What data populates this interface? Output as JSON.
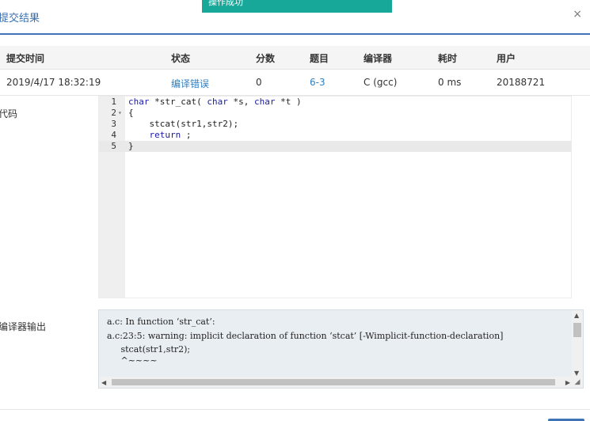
{
  "toast": {
    "text": "操作成功"
  },
  "header": {
    "title": "提交结果",
    "close_icon": "×"
  },
  "table": {
    "columns": [
      "提交时间",
      "状态",
      "分数",
      "题目",
      "编译器",
      "耗时",
      "用户"
    ],
    "row": [
      "2019/4/17 18:32:19",
      "编译错误",
      "0",
      "6-3",
      "C (gcc)",
      "0 ms",
      "20188721"
    ]
  },
  "labels": {
    "code": "代码",
    "compiler_output": "编译器输出"
  },
  "code_lines": [
    {
      "num": "1",
      "fold": ""
    },
    {
      "num": "2",
      "fold": "▾"
    },
    {
      "num": "3",
      "fold": ""
    },
    {
      "num": "4",
      "fold": ""
    },
    {
      "num": "5",
      "fold": ""
    }
  ],
  "code_text": {
    "l1_kw1": "char",
    "l1_a": " *str_cat( ",
    "l1_kw2": "char",
    "l1_b": " *s, ",
    "l1_kw3": "char",
    "l1_c": " *t )",
    "l2": "{",
    "l3": "    stcat(str1,str2);",
    "l4_indent": "    ",
    "l4_kw": "return",
    "l4_rest": " ;",
    "l5": "}"
  },
  "compiler_output": [
    "a.c: In function ‘str_cat’:",
    "a.c:23:5: warning: implicit declaration of function ‘stcat’ [-Wimplicit-function-declaration]",
    "     stcat(str1,str2);",
    "     ^~~~~"
  ],
  "colors": {
    "accent": "#3f74b8",
    "link": "#2f7fc1",
    "toast": "#17a899"
  }
}
